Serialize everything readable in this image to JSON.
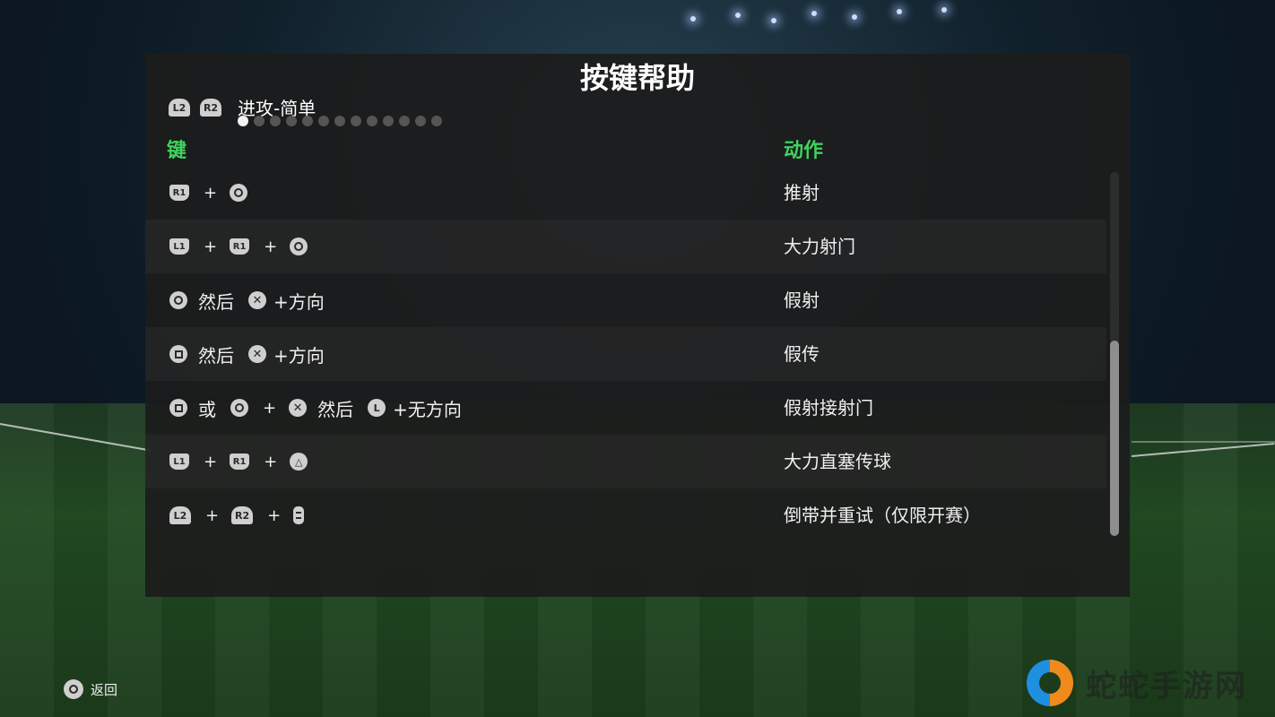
{
  "title": "按键帮助",
  "section": {
    "label": "进攻-简单",
    "left_buttons": [
      "L2",
      "R2"
    ],
    "page_count": 13,
    "active_page": 1
  },
  "columns": {
    "keys": "键",
    "action": "动作"
  },
  "rows": [
    {
      "action": "推射"
    },
    {
      "action": "大力射门"
    },
    {
      "action": "假射",
      "w1": "然后",
      "w2": "+方向"
    },
    {
      "action": "假传",
      "w1": "然后",
      "w2": "+方向"
    },
    {
      "action": "假射接射门",
      "w1": "或",
      "w2": "然后",
      "w3": "+无方向"
    },
    {
      "action": "大力直塞传球"
    },
    {
      "action": "倒带并重试（仅限开赛）"
    }
  ],
  "button_labels": {
    "L1": "L1",
    "R1": "R1",
    "L2": "L2",
    "R2": "R2",
    "L": "L"
  },
  "footer": {
    "back_label": "返回"
  },
  "watermark": {
    "text": "蛇蛇手游网"
  },
  "colors": {
    "accent": "#3fd35f",
    "panel": "#1c1c1c",
    "button": "#cfcfcf"
  },
  "icons": [
    "circle-button-icon",
    "square-button-icon",
    "cross-button-icon",
    "triangle-button-icon",
    "options-button-icon",
    "l1-button-icon",
    "r1-button-icon",
    "l2-trigger-icon",
    "r2-trigger-icon",
    "l-stick-icon"
  ]
}
